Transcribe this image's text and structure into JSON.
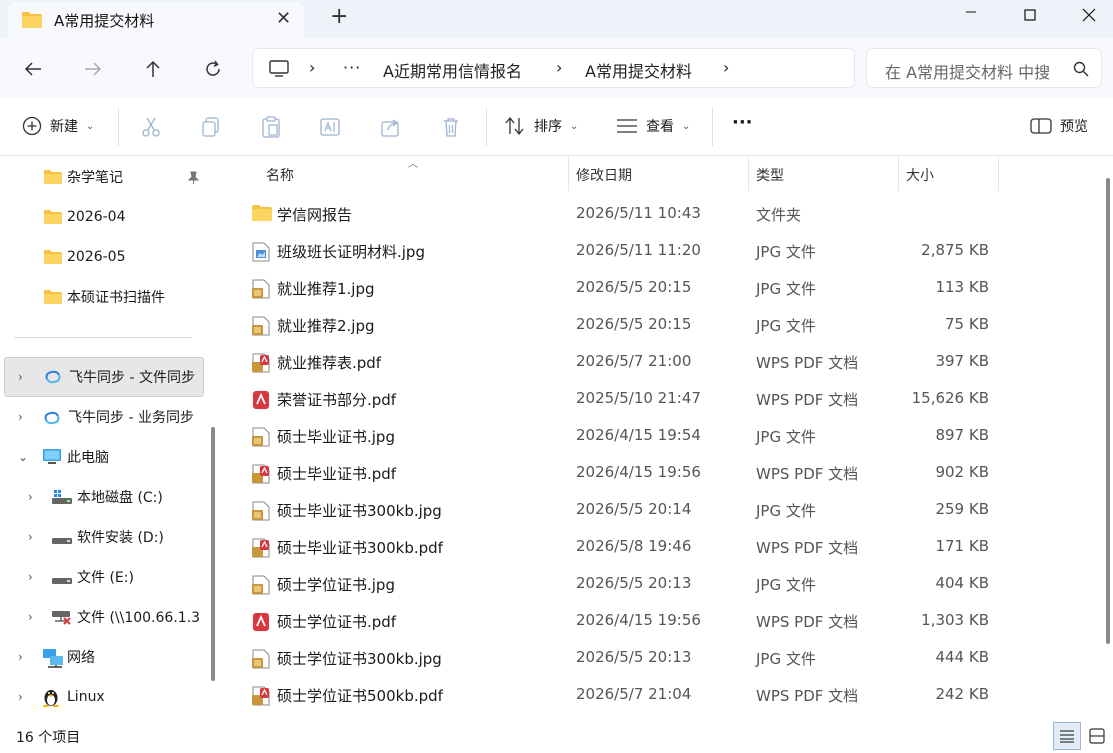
{
  "window": {
    "tab_title": "A常用提交材料",
    "new_tab": "+",
    "close_tab": "✕"
  },
  "breadcrumb": {
    "more": "···",
    "items": [
      "A近期常用信情报名",
      "A常用提交材料"
    ]
  },
  "search": {
    "placeholder": "在 A常用提交材料 中搜索"
  },
  "toolbar": {
    "new_label": "新建",
    "sort_label": "排序",
    "view_label": "查看",
    "more_label": "···",
    "preview_label": "预览"
  },
  "sidebar": {
    "items": [
      {
        "label": "杂学笔记",
        "icon": "folder-icon"
      },
      {
        "label": "2026-04",
        "icon": "folder-icon"
      },
      {
        "label": "2026-05",
        "icon": "folder-icon"
      },
      {
        "label": "本硕证书扫描件",
        "icon": "folder-icon"
      },
      {
        "label": "飞牛同步 - 文件同步",
        "icon": "sync-icon"
      },
      {
        "label": "飞牛同步 - 业务同步",
        "icon": "sync-icon"
      },
      {
        "label": "此电脑",
        "icon": "pc-icon"
      },
      {
        "label": "本地磁盘 (C:)",
        "icon": "drive-c-icon"
      },
      {
        "label": "软件安装 (D:)",
        "icon": "drive-icon"
      },
      {
        "label": "文件 (E:)",
        "icon": "drive-icon"
      },
      {
        "label": "文件 (\\\\100.66.1.3",
        "icon": "network-drive-icon"
      },
      {
        "label": "网络",
        "icon": "network-icon"
      },
      {
        "label": "Linux",
        "icon": "linux-icon"
      }
    ]
  },
  "columns": {
    "name": "名称",
    "date": "修改日期",
    "type": "类型",
    "size": "大小"
  },
  "files": [
    {
      "name": "学信网报告",
      "date": "2026/5/11 10:43",
      "type": "文件夹",
      "size": "",
      "icon": "folder"
    },
    {
      "name": "班级班长证明材料.jpg",
      "date": "2026/5/11 11:20",
      "type": "JPG 文件",
      "size": "2,875 KB",
      "icon": "jpg-blue"
    },
    {
      "name": "就业推荐1.jpg",
      "date": "2026/5/5 20:15",
      "type": "JPG 文件",
      "size": "113 KB",
      "icon": "jpg"
    },
    {
      "name": "就业推荐2.jpg",
      "date": "2026/5/5 20:15",
      "type": "JPG 文件",
      "size": "75 KB",
      "icon": "jpg"
    },
    {
      "name": "就业推荐表.pdf",
      "date": "2026/5/7 21:00",
      "type": "WPS PDF 文档",
      "size": "397 KB",
      "icon": "pdf"
    },
    {
      "name": "荣誉证书部分.pdf",
      "date": "2025/5/10 21:47",
      "type": "WPS PDF 文档",
      "size": "15,626 KB",
      "icon": "pdf-red"
    },
    {
      "name": "硕士毕业证书.jpg",
      "date": "2026/4/15 19:54",
      "type": "JPG 文件",
      "size": "897 KB",
      "icon": "jpg"
    },
    {
      "name": "硕士毕业证书.pdf",
      "date": "2026/4/15 19:56",
      "type": "WPS PDF 文档",
      "size": "902 KB",
      "icon": "pdf"
    },
    {
      "name": "硕士毕业证书300kb.jpg",
      "date": "2026/5/5 20:14",
      "type": "JPG 文件",
      "size": "259 KB",
      "icon": "jpg"
    },
    {
      "name": "硕士毕业证书300kb.pdf",
      "date": "2026/5/8 19:46",
      "type": "WPS PDF 文档",
      "size": "171 KB",
      "icon": "pdf"
    },
    {
      "name": "硕士学位证书.jpg",
      "date": "2026/5/5 20:13",
      "type": "JPG 文件",
      "size": "404 KB",
      "icon": "jpg"
    },
    {
      "name": "硕士学位证书.pdf",
      "date": "2026/4/15 19:56",
      "type": "WPS PDF 文档",
      "size": "1,303 KB",
      "icon": "pdf-red"
    },
    {
      "name": "硕士学位证书300kb.jpg",
      "date": "2026/5/5 20:13",
      "type": "JPG 文件",
      "size": "444 KB",
      "icon": "jpg"
    },
    {
      "name": "硕士学位证书500kb.pdf",
      "date": "2026/5/7 21:04",
      "type": "WPS PDF 文档",
      "size": "242 KB",
      "icon": "pdf"
    }
  ],
  "status": {
    "count": "16 个项目"
  },
  "colors": {
    "folder": "#f5c242",
    "pdf_red": "#d9363e",
    "accent": "#0067c0"
  }
}
